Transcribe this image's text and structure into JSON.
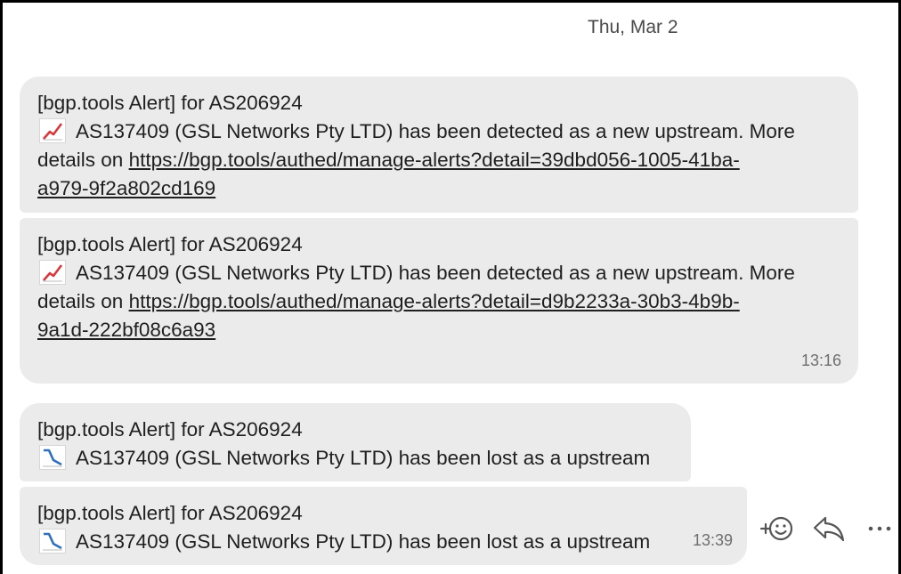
{
  "date_separator": "Thu, Mar 2",
  "messages": [
    {
      "title": "[bgp.tools Alert] for AS206924",
      "emoji": "chart-increasing-icon",
      "text": "AS137409 (GSL Networks Pty LTD) has been detected as a new upstream. More",
      "details_prefix": "details on ",
      "link_part1": "https://bgp.tools/authed/manage-alerts?detail=39dbd056-1005-41ba-",
      "link_part2": "a979-9f2a802cd169",
      "time": ""
    },
    {
      "title": "[bgp.tools Alert] for AS206924",
      "emoji": "chart-increasing-icon",
      "text": "AS137409 (GSL Networks Pty LTD) has been detected as a new upstream. More",
      "details_prefix": "details on ",
      "link_part1": "https://bgp.tools/authed/manage-alerts?detail=d9b2233a-30b3-4b9b-",
      "link_part2": "9a1d-222bf08c6a93",
      "time": "13:16"
    },
    {
      "title": "[bgp.tools Alert] for AS206924",
      "emoji": "chart-decreasing-icon",
      "text": "AS137409 (GSL Networks Pty LTD) has been lost as a upstream",
      "time": ""
    },
    {
      "title": "[bgp.tools Alert] for AS206924",
      "emoji": "chart-decreasing-icon",
      "text": "AS137409 (GSL Networks Pty LTD) has been lost as a upstream",
      "time": "13:39"
    }
  ],
  "actions": {
    "react_icon": "add-reaction-icon",
    "reply_icon": "reply-icon",
    "more_icon": "more-options-icon"
  },
  "colors": {
    "bubble": "#ebebeb",
    "text": "#1f1f1f",
    "timestamp": "#6e6e6e",
    "chart_up": "#d9383a",
    "chart_down": "#2f6fbf"
  }
}
